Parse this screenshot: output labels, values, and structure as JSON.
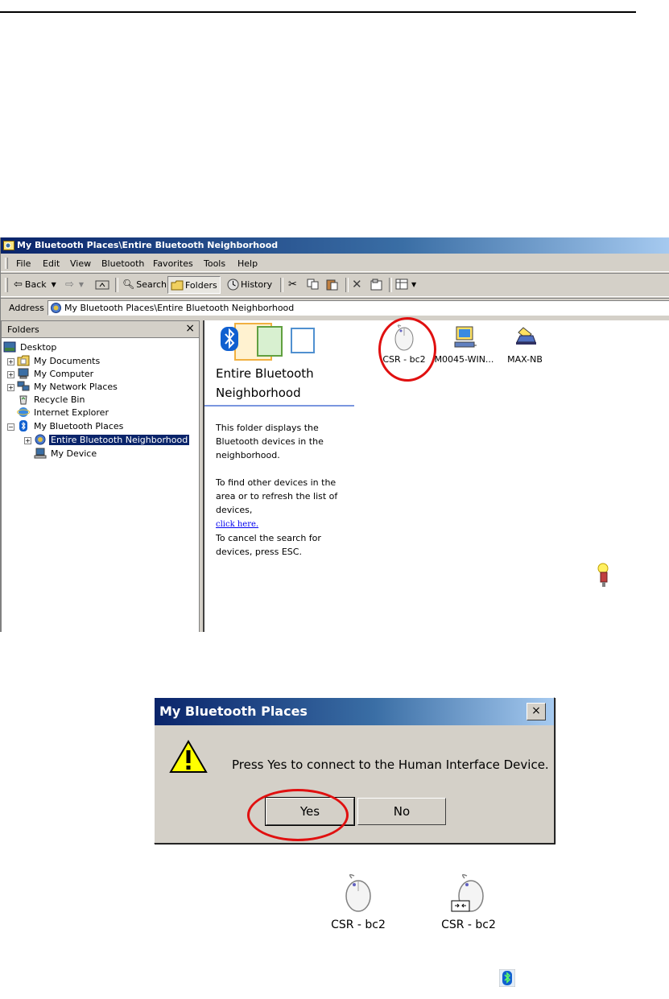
{
  "window": {
    "title": "My Bluetooth Places\\Entire Bluetooth Neighborhood",
    "menu": [
      "File",
      "Edit",
      "View",
      "Bluetooth",
      "Favorites",
      "Tools",
      "Help"
    ],
    "toolbar": {
      "back": "Back",
      "search": "Search",
      "folders": "Folders",
      "history": "History"
    },
    "address_label": "Address",
    "address_value": "My Bluetooth Places\\Entire Bluetooth Neighborhood"
  },
  "folders_pane": {
    "title": "Folders",
    "close": "×",
    "items": [
      {
        "label": "Desktop"
      },
      {
        "label": "My Documents"
      },
      {
        "label": "My Computer"
      },
      {
        "label": "My Network Places"
      },
      {
        "label": "Recycle Bin"
      },
      {
        "label": "Internet Explorer"
      },
      {
        "label": "My Bluetooth Places"
      },
      {
        "label": "Entire Bluetooth Neighborhood"
      },
      {
        "label": "My Device"
      }
    ]
  },
  "panel": {
    "title": "Entire Bluetooth Neighborhood",
    "desc": "This folder displays the Bluetooth devices in the neighborhood.",
    "find": "To find other devices in the area or to refresh the list of devices,",
    "link": "click here.",
    "cancel": "To cancel the search for devices, press ESC."
  },
  "devices": [
    {
      "label": "CSR - bc2",
      "icon": "mouse-icon"
    },
    {
      "label": "M0045-WIN...",
      "icon": "computer-icon"
    },
    {
      "label": "MAX-NB",
      "icon": "laptop-icon"
    }
  ],
  "dialog": {
    "title": "My Bluetooth Places",
    "close": "×",
    "message": "Press Yes to connect to the Human Interface Device.",
    "yes": "Yes",
    "no": "No"
  },
  "bottom_devices": [
    {
      "label": "CSR - bc2",
      "state": "disconnected"
    },
    {
      "label": "CSR - bc2",
      "state": "connected"
    }
  ],
  "colors": {
    "title_start": "#0a246a",
    "title_end": "#a6caf0",
    "highlight_circle": "#e01010",
    "selection": "#0a246a"
  }
}
